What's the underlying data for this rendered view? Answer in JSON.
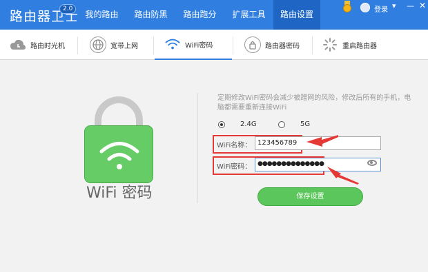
{
  "app": {
    "title": "路由器卫士",
    "version": "2.0"
  },
  "nav": {
    "items": [
      {
        "label": "我的路由"
      },
      {
        "label": "路由防黑"
      },
      {
        "label": "路由跑分"
      },
      {
        "label": "扩展工具"
      },
      {
        "label": "路由设置",
        "active": true
      }
    ]
  },
  "user": {
    "login_label": "登录"
  },
  "window_controls": {
    "menu": "▾",
    "minimize": "—",
    "close": "✕"
  },
  "subtabs": [
    {
      "label": "路由时光机",
      "icon": "cloud-icon"
    },
    {
      "label": "宽带上网",
      "icon": "globe-icon"
    },
    {
      "label": "WiFi密码",
      "icon": "wifi-icon",
      "active": true
    },
    {
      "label": "路由器密码",
      "icon": "lock-icon"
    },
    {
      "label": "重启路由器",
      "icon": "restart-icon"
    }
  ],
  "panel": {
    "title": "WiFi 密码",
    "notice": "定期修改WiFi密码会减少被蹭网的风险，修改后所有的手机，电脑都需要重新连接WiFi",
    "band": {
      "options": [
        "2.4G",
        "5G"
      ],
      "selected": "2.4G"
    },
    "ssid": {
      "label": "WiFi名称：",
      "value": "123456789"
    },
    "password": {
      "label": "WiFi密码：",
      "value": "●●●●●●●●●●●●●●"
    },
    "save_label": "保存设置"
  },
  "colors": {
    "brand_blue": "#2f7ee0",
    "save_green": "#5bc65b",
    "annotation_red": "#e53935"
  }
}
